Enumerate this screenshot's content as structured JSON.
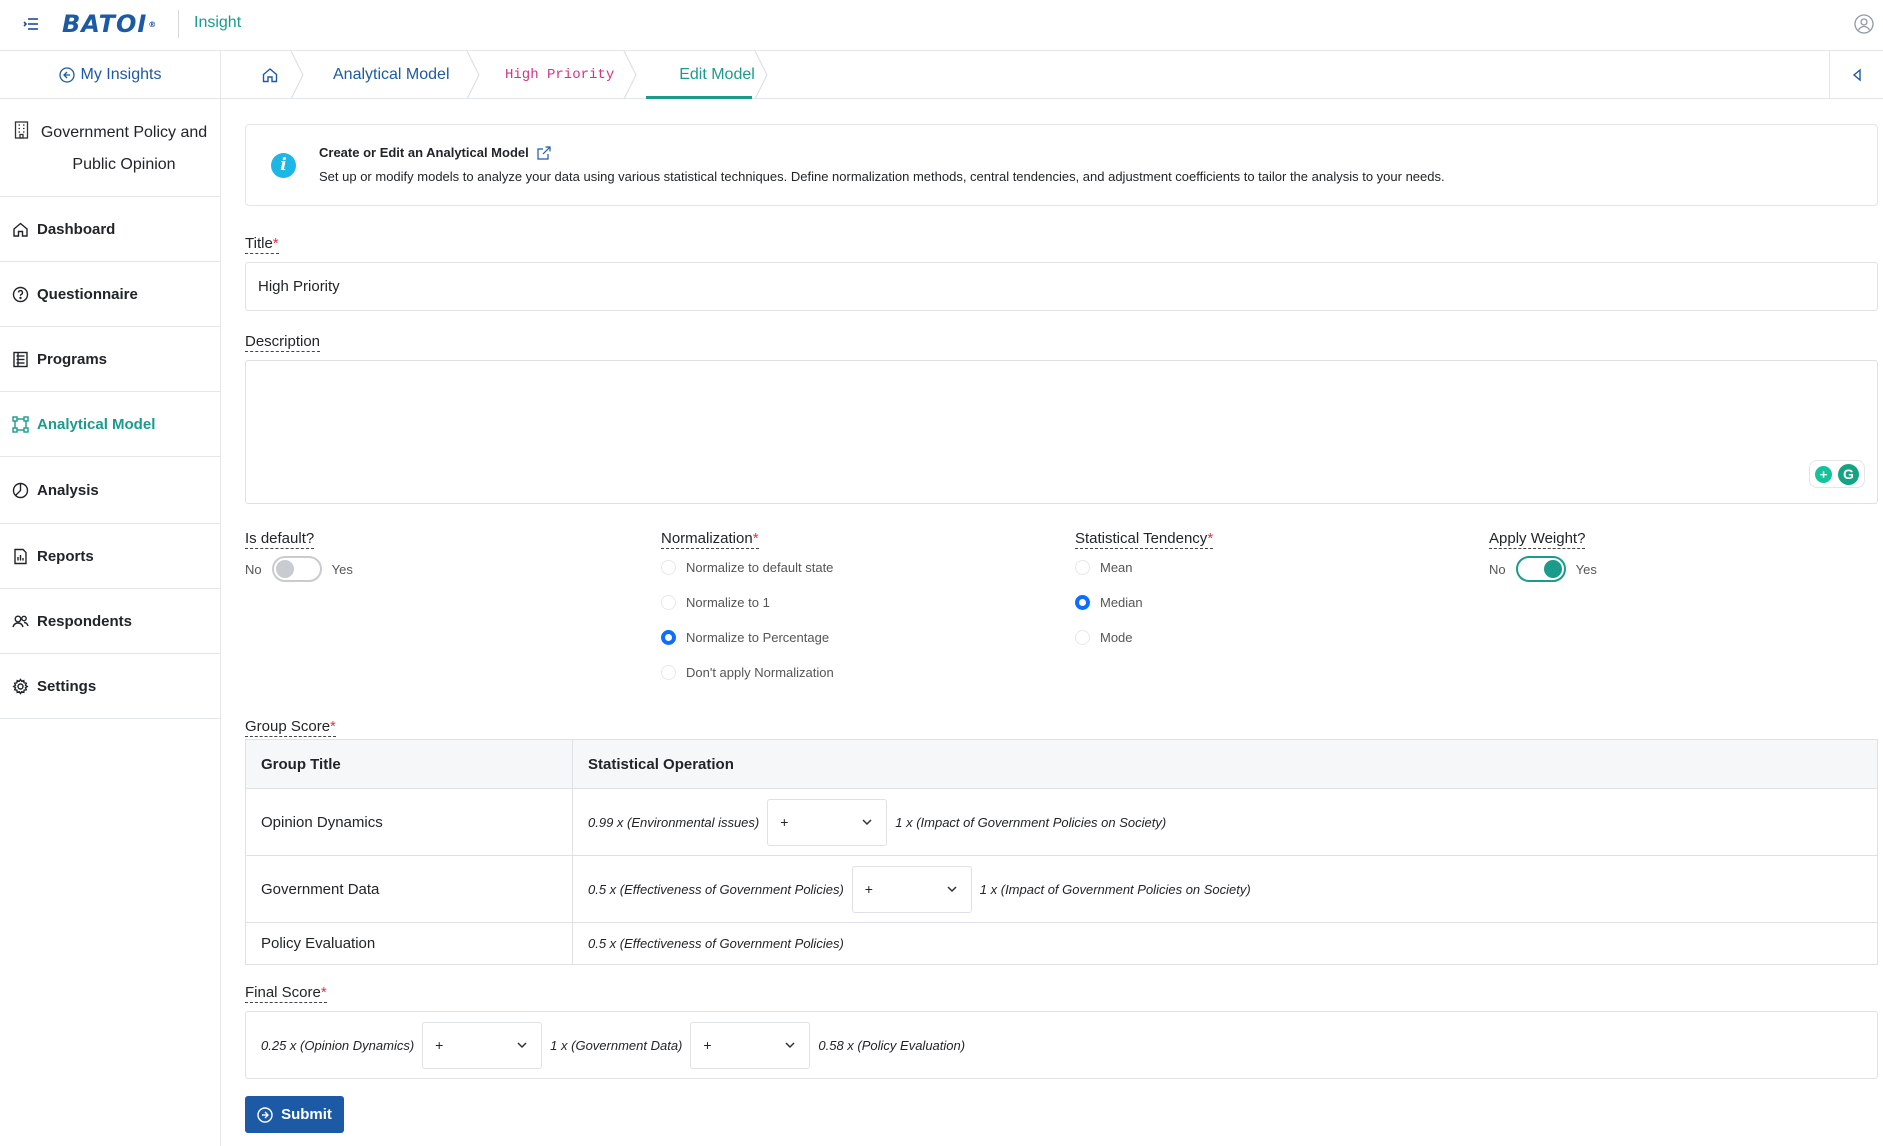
{
  "app": {
    "logo_text": "BATOI",
    "name": "Insight"
  },
  "sidebar": {
    "my_insights": "My Insights",
    "project": "Government Policy and Public Opinion",
    "items": [
      {
        "label": "Dashboard",
        "icon": "home-icon"
      },
      {
        "label": "Questionnaire",
        "icon": "question-circle-icon"
      },
      {
        "label": "Programs",
        "icon": "document-list-icon"
      },
      {
        "label": "Analytical Model",
        "icon": "model-nodes-icon",
        "active": true
      },
      {
        "label": "Analysis",
        "icon": "pie-chart-icon"
      },
      {
        "label": "Reports",
        "icon": "report-icon"
      },
      {
        "label": "Respondents",
        "icon": "users-icon"
      },
      {
        "label": "Settings",
        "icon": "gear-icon"
      }
    ]
  },
  "breadcrumb": {
    "items": [
      "Analytical Model",
      "High Priority",
      "Edit Model"
    ]
  },
  "info": {
    "title": "Create or Edit an Analytical Model",
    "description": "Set up or modify models to analyze your data using various statistical techniques. Define normalization methods, central tendencies, and adjustment coefficients to tailor the analysis to your needs."
  },
  "form": {
    "title_label": "Title",
    "title_value": "High Priority",
    "description_label": "Description",
    "description_value": "",
    "is_default": {
      "label": "Is default?",
      "no": "No",
      "yes": "Yes",
      "value": false
    },
    "normalization": {
      "label": "Normalization",
      "options": [
        "Normalize to default state",
        "Normalize to 1",
        "Normalize to Percentage",
        "Don't apply Normalization"
      ],
      "selected": "Normalize to Percentage"
    },
    "statistical_tendency": {
      "label": "Statistical Tendency",
      "options": [
        "Mean",
        "Median",
        "Mode"
      ],
      "selected": "Median"
    },
    "apply_weight": {
      "label": "Apply Weight?",
      "no": "No",
      "yes": "Yes",
      "value": true
    },
    "required_mark": "*"
  },
  "group_score": {
    "label": "Group Score",
    "headers": [
      "Group Title",
      "Statistical Operation"
    ],
    "rows": [
      {
        "title": "Opinion Dynamics",
        "term1": "0.99 x (Environmental issues)",
        "operator": "+",
        "term2": "1 x (Impact of Government Policies on Society)"
      },
      {
        "title": "Government Data",
        "term1": "0.5 x (Effectiveness of Government Policies)",
        "operator": "+",
        "term2": "1 x (Impact of Government Policies on Society)"
      },
      {
        "title": "Policy Evaluation",
        "term1": "0.5 x (Effectiveness of Government Policies)"
      }
    ]
  },
  "final_score": {
    "label": "Final Score",
    "term1": "0.25 x (Opinion Dynamics)",
    "op1": "+",
    "term2": "1 x (Government Data)",
    "op2": "+",
    "term3": "0.58 x (Policy Evaluation)"
  },
  "submit_label": "Submit",
  "colors": {
    "primary": "#1d5aa6",
    "accent": "#1a9b8c",
    "required": "#dc3545",
    "radio": "#0d6efd"
  }
}
